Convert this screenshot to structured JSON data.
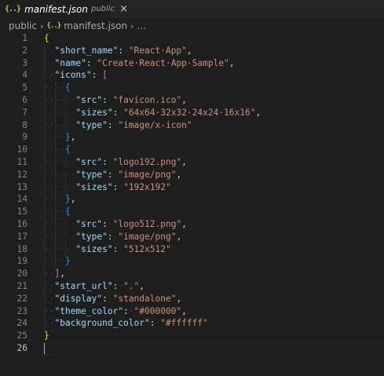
{
  "tab": {
    "icon": "{..}",
    "title": "manifest.json",
    "description": "public",
    "close": "×"
  },
  "breadcrumb": {
    "folder": "public",
    "sep1": "›",
    "file_icon": "{..}",
    "file": "manifest.json",
    "sep2": "›",
    "more": "..."
  },
  "lines": [
    {
      "n": "1",
      "tokens": [
        [
          "b1",
          "{"
        ]
      ]
    },
    {
      "n": "2",
      "tokens": [
        [
          "ws",
          "··"
        ],
        [
          "k",
          "\"short_name\""
        ],
        [
          "p",
          ":"
        ],
        [
          "ws",
          "·"
        ],
        [
          "s",
          "\"React·App\""
        ],
        [
          "p",
          ","
        ]
      ]
    },
    {
      "n": "3",
      "tokens": [
        [
          "ws",
          "··"
        ],
        [
          "k",
          "\"name\""
        ],
        [
          "p",
          ":"
        ],
        [
          "ws",
          "·"
        ],
        [
          "s",
          "\"Create·React·App·Sample\""
        ],
        [
          "p",
          ","
        ]
      ]
    },
    {
      "n": "4",
      "tokens": [
        [
          "ws",
          "··"
        ],
        [
          "k",
          "\"icons\""
        ],
        [
          "p",
          ":"
        ],
        [
          "ws",
          "·"
        ],
        [
          "b2",
          "["
        ]
      ]
    },
    {
      "n": "5",
      "tokens": [
        [
          "ws",
          "····"
        ],
        [
          "b3",
          "{"
        ]
      ]
    },
    {
      "n": "6",
      "tokens": [
        [
          "ws",
          "······"
        ],
        [
          "k",
          "\"src\""
        ],
        [
          "p",
          ":"
        ],
        [
          "ws",
          "·"
        ],
        [
          "s",
          "\"favicon.ico\""
        ],
        [
          "p",
          ","
        ]
      ]
    },
    {
      "n": "7",
      "tokens": [
        [
          "ws",
          "······"
        ],
        [
          "k",
          "\"sizes\""
        ],
        [
          "p",
          ":"
        ],
        [
          "ws",
          "·"
        ],
        [
          "s",
          "\"64x64·32x32·24x24·16x16\""
        ],
        [
          "p",
          ","
        ]
      ]
    },
    {
      "n": "8",
      "tokens": [
        [
          "ws",
          "······"
        ],
        [
          "k",
          "\"type\""
        ],
        [
          "p",
          ":"
        ],
        [
          "ws",
          "·"
        ],
        [
          "s",
          "\"image/x-icon\""
        ]
      ]
    },
    {
      "n": "9",
      "tokens": [
        [
          "ws",
          "····"
        ],
        [
          "b3",
          "}"
        ],
        [
          "p",
          ","
        ]
      ]
    },
    {
      "n": "10",
      "tokens": [
        [
          "ws",
          "····"
        ],
        [
          "b3",
          "{"
        ]
      ]
    },
    {
      "n": "11",
      "tokens": [
        [
          "ws",
          "······"
        ],
        [
          "k",
          "\"src\""
        ],
        [
          "p",
          ":"
        ],
        [
          "ws",
          "·"
        ],
        [
          "s",
          "\"logo192.png\""
        ],
        [
          "p",
          ","
        ]
      ]
    },
    {
      "n": "12",
      "tokens": [
        [
          "ws",
          "······"
        ],
        [
          "k",
          "\"type\""
        ],
        [
          "p",
          ":"
        ],
        [
          "ws",
          "·"
        ],
        [
          "s",
          "\"image/png\""
        ],
        [
          "p",
          ","
        ]
      ]
    },
    {
      "n": "13",
      "tokens": [
        [
          "ws",
          "······"
        ],
        [
          "k",
          "\"sizes\""
        ],
        [
          "p",
          ":"
        ],
        [
          "ws",
          "·"
        ],
        [
          "s",
          "\"192x192\""
        ]
      ]
    },
    {
      "n": "14",
      "tokens": [
        [
          "ws",
          "····"
        ],
        [
          "b3",
          "}"
        ],
        [
          "p",
          ","
        ]
      ]
    },
    {
      "n": "15",
      "tokens": [
        [
          "ws",
          "····"
        ],
        [
          "b3",
          "{"
        ]
      ]
    },
    {
      "n": "16",
      "tokens": [
        [
          "ws",
          "······"
        ],
        [
          "k",
          "\"src\""
        ],
        [
          "p",
          ":"
        ],
        [
          "ws",
          "·"
        ],
        [
          "s",
          "\"logo512.png\""
        ],
        [
          "p",
          ","
        ]
      ]
    },
    {
      "n": "17",
      "tokens": [
        [
          "ws",
          "······"
        ],
        [
          "k",
          "\"type\""
        ],
        [
          "p",
          ":"
        ],
        [
          "ws",
          "·"
        ],
        [
          "s",
          "\"image/png\""
        ],
        [
          "p",
          ","
        ]
      ]
    },
    {
      "n": "18",
      "tokens": [
        [
          "ws",
          "······"
        ],
        [
          "k",
          "\"sizes\""
        ],
        [
          "p",
          ":"
        ],
        [
          "ws",
          "·"
        ],
        [
          "s",
          "\"512x512\""
        ]
      ]
    },
    {
      "n": "19",
      "tokens": [
        [
          "ws",
          "····"
        ],
        [
          "b3",
          "}"
        ]
      ]
    },
    {
      "n": "20",
      "tokens": [
        [
          "ws",
          "··"
        ],
        [
          "b2",
          "]"
        ],
        [
          "p",
          ","
        ]
      ]
    },
    {
      "n": "21",
      "tokens": [
        [
          "ws",
          "··"
        ],
        [
          "k",
          "\"start_url\""
        ],
        [
          "p",
          ":"
        ],
        [
          "ws",
          "·"
        ],
        [
          "s",
          "\".\""
        ],
        [
          "p",
          ","
        ]
      ]
    },
    {
      "n": "22",
      "tokens": [
        [
          "ws",
          "··"
        ],
        [
          "k",
          "\"display\""
        ],
        [
          "p",
          ":"
        ],
        [
          "ws",
          "·"
        ],
        [
          "s",
          "\"standalone\""
        ],
        [
          "p",
          ","
        ]
      ]
    },
    {
      "n": "23",
      "tokens": [
        [
          "ws",
          "··"
        ],
        [
          "k",
          "\"theme_color\""
        ],
        [
          "p",
          ":"
        ],
        [
          "ws",
          "·"
        ],
        [
          "s",
          "\"#000000\""
        ],
        [
          "p",
          ","
        ]
      ]
    },
    {
      "n": "24",
      "tokens": [
        [
          "ws",
          "··"
        ],
        [
          "k",
          "\"background_color\""
        ],
        [
          "p",
          ":"
        ],
        [
          "ws",
          "·"
        ],
        [
          "s",
          "\"#ffffff\""
        ]
      ]
    },
    {
      "n": "25",
      "tokens": [
        [
          "b1",
          "}"
        ]
      ]
    },
    {
      "n": "26",
      "tokens": []
    }
  ],
  "active_line": "26",
  "colors": {
    "background": "#1e1e1e",
    "key": "#9cdcfe",
    "string": "#ce9178",
    "bracket_level1": "#ffd700",
    "bracket_level2": "#da70d6",
    "bracket_level3": "#179fff",
    "line_number": "#858585",
    "json_icon": "#cbcb41"
  }
}
